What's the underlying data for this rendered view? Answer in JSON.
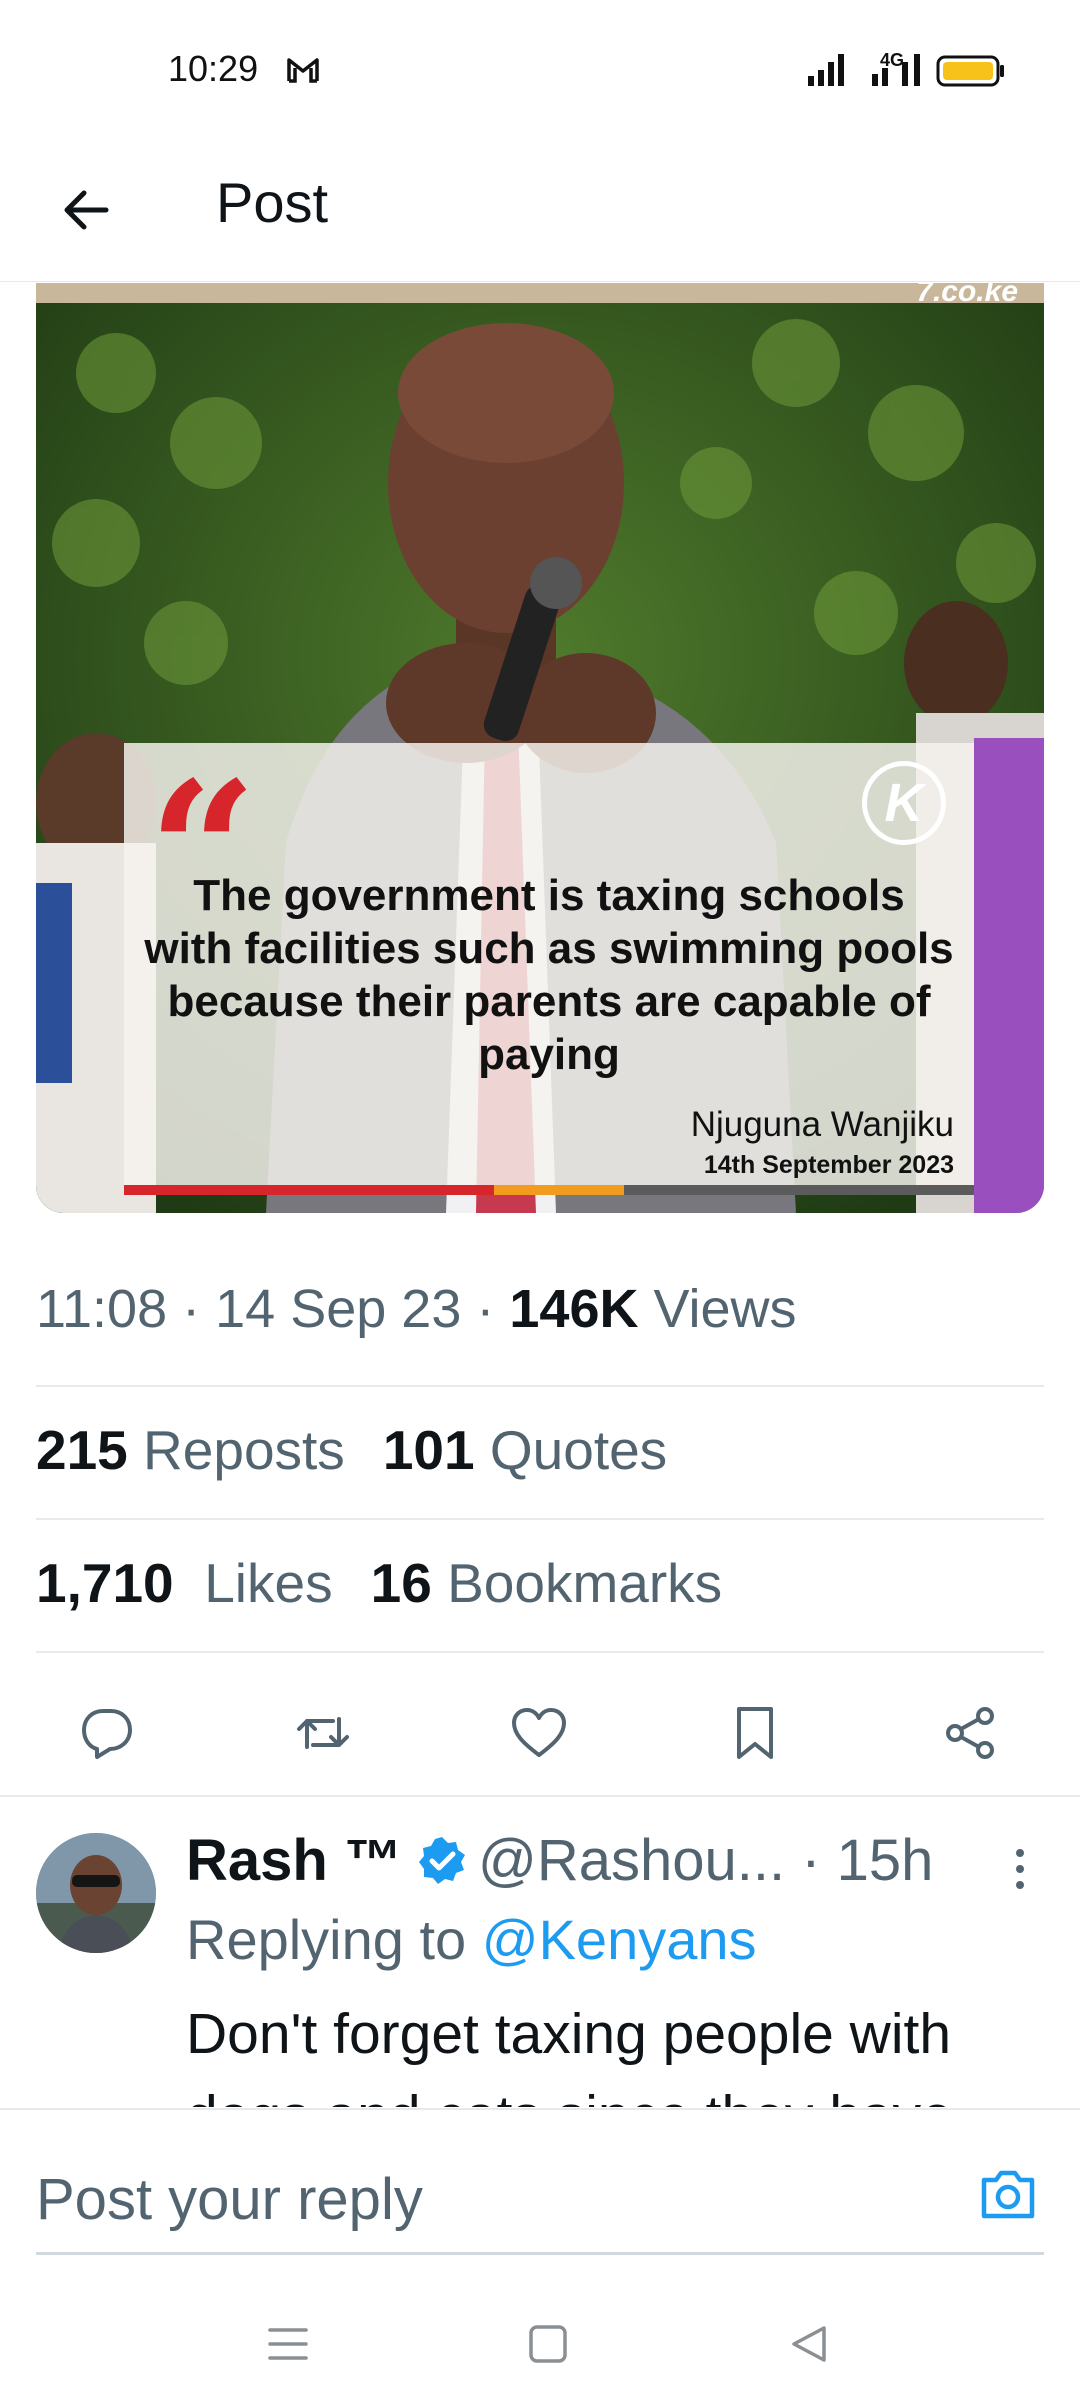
{
  "status_bar": {
    "time": "10:29",
    "network_label": "4G"
  },
  "header": {
    "title": "Post"
  },
  "media": {
    "watermark": "7.co.ke",
    "quote": "The government is taxing schools with facilities such as swimming pools because their parents are capable of paying",
    "author": "Njuguna Wanjiku",
    "date": "14th September 2023",
    "logo_letter": "K"
  },
  "meta": {
    "time": "11:08",
    "date": "14 Sep 23",
    "views_count": "146K",
    "views_label": "Views",
    "separator": "·"
  },
  "stats": {
    "reposts_count": "215",
    "reposts_label": "Reposts",
    "quotes_count": "101",
    "quotes_label": "Quotes",
    "likes_count": "1,710",
    "likes_label": "Likes",
    "bookmarks_count": "16",
    "bookmarks_label": "Bookmarks"
  },
  "actions": [
    "reply-icon",
    "repost-icon",
    "like-icon",
    "bookmark-icon",
    "share-icon"
  ],
  "reply": {
    "name": "Rash ™",
    "handle": "@Rashou...",
    "time": "· 15h",
    "replying_prefix": "Replying to",
    "replying_to": "@Kenyans",
    "text": "Don't forget  taxing people with dogs and cats since they have"
  },
  "composer": {
    "placeholder": "Post your reply"
  },
  "colors": {
    "accent": "#1d9bf0",
    "text": "#0f1419",
    "muted": "#536471",
    "divider": "#e7e9ea"
  }
}
